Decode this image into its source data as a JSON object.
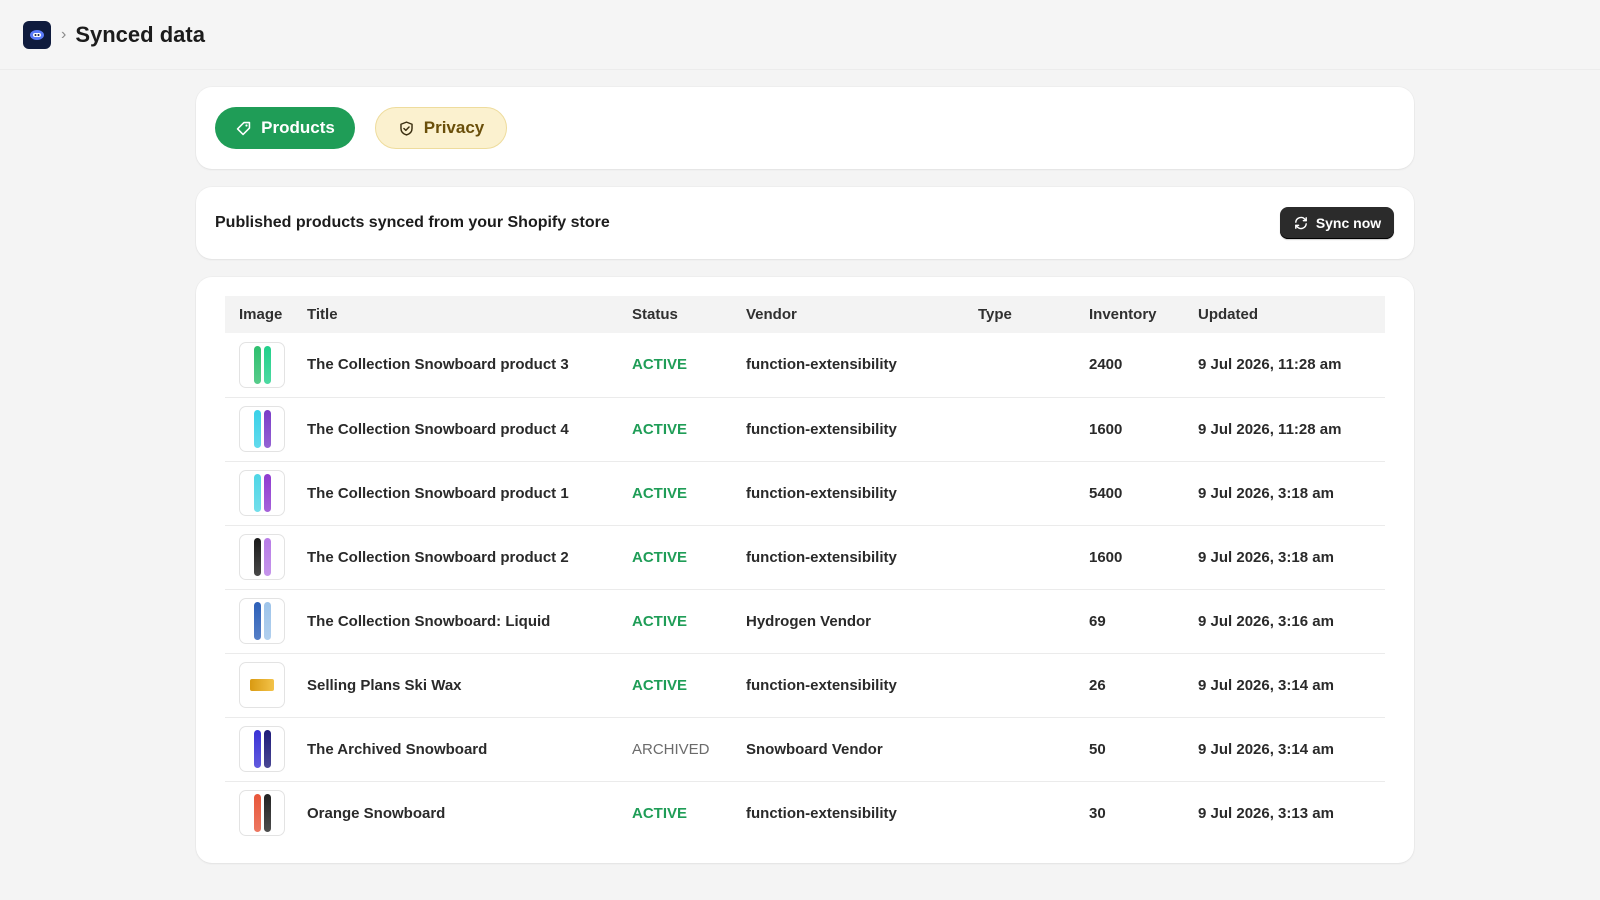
{
  "header": {
    "breadcrumb_separator": "›",
    "title": "Synced data"
  },
  "tabs": [
    {
      "label": "Products",
      "icon": "tag-icon",
      "active": true
    },
    {
      "label": "Privacy",
      "icon": "shield-check-icon",
      "active": false
    }
  ],
  "section": {
    "description": "Published products synced from your Shopify store",
    "sync_button_label": "Sync now"
  },
  "table": {
    "columns": [
      "Image",
      "Title",
      "Status",
      "Vendor",
      "Type",
      "Inventory",
      "Updated"
    ],
    "rows": [
      {
        "title": "The Collection Snowboard product 3",
        "status": "ACTIVE",
        "vendor": "function-extensibility",
        "type": "",
        "inventory": "2400",
        "updated": "9 Jul 2026, 11:28 am",
        "thumb": [
          "#2ebf6e",
          "#21d08a"
        ]
      },
      {
        "title": "The Collection Snowboard product 4",
        "status": "ACTIVE",
        "vendor": "function-extensibility",
        "type": "",
        "inventory": "1600",
        "updated": "9 Jul 2026, 11:28 am",
        "thumb": [
          "#3ad1e8",
          "#7a3cc8"
        ]
      },
      {
        "title": "The Collection Snowboard product 1",
        "status": "ACTIVE",
        "vendor": "function-extensibility",
        "type": "",
        "inventory": "5400",
        "updated": "9 Jul 2026, 3:18 am",
        "thumb": [
          "#4fd6e6",
          "#8f3bd0"
        ]
      },
      {
        "title": "The Collection Snowboard product 2",
        "status": "ACTIVE",
        "vendor": "function-extensibility",
        "type": "",
        "inventory": "1600",
        "updated": "9 Jul 2026, 3:18 am",
        "thumb": [
          "#1a1a1a",
          "#b77be6"
        ]
      },
      {
        "title": "The Collection Snowboard: Liquid",
        "status": "ACTIVE",
        "vendor": "Hydrogen Vendor",
        "type": "",
        "inventory": "69",
        "updated": "9 Jul 2026, 3:16 am",
        "thumb": [
          "#2c5fb8",
          "#9ec4ea"
        ]
      },
      {
        "title": "Selling Plans Ski Wax",
        "status": "ACTIVE",
        "vendor": "function-extensibility",
        "type": "",
        "inventory": "26",
        "updated": "9 Jul 2026, 3:14 am",
        "thumb": [
          "wax"
        ]
      },
      {
        "title": "The Archived Snowboard",
        "status": "ARCHIVED",
        "vendor": "Snowboard Vendor",
        "type": "",
        "inventory": "50",
        "updated": "9 Jul 2026, 3:14 am",
        "thumb": [
          "#3a32d6",
          "#1d1a7a"
        ]
      },
      {
        "title": "Orange Snowboard",
        "status": "ACTIVE",
        "vendor": "function-extensibility",
        "type": "",
        "inventory": "30",
        "updated": "9 Jul 2026, 3:13 am",
        "thumb": [
          "#e8563a",
          "#222222"
        ]
      }
    ]
  },
  "colors": {
    "accent_green": "#1f9d57",
    "privacy_bg": "#fbf1cf",
    "archived_gray": "#6b6b6b"
  }
}
